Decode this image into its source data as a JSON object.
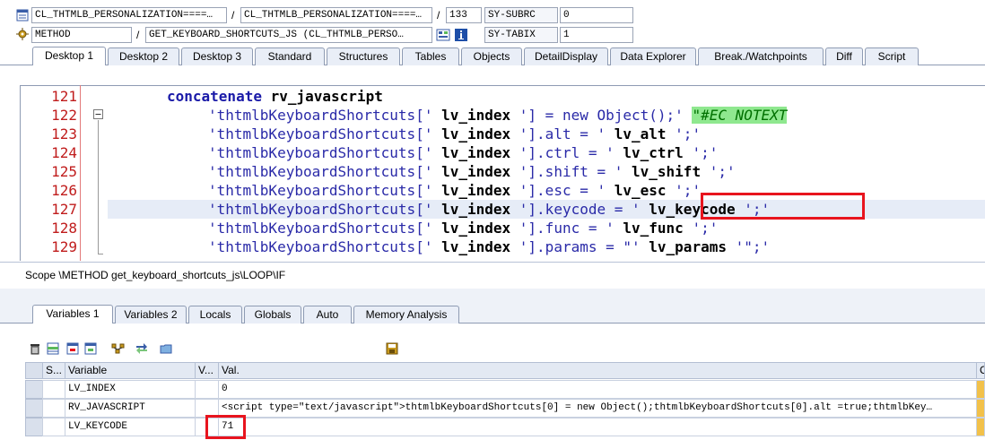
{
  "header": {
    "row1": {
      "class1": "CL_THTMLB_PERSONALIZATION====…",
      "class2": "CL_THTMLB_PERSONALIZATION====…",
      "line": "133",
      "sysvar": "SY-SUBRC",
      "sysval": "0"
    },
    "row2": {
      "type": "METHOD",
      "method": "GET_KEYBOARD_SHORTCUTS_JS (CL_THTMLB_PERSO…",
      "sysvar": "SY-TABIX",
      "sysval": "1"
    }
  },
  "tabs": [
    "Desktop 1",
    "Desktop 2",
    "Desktop 3",
    "Standard",
    "Structures",
    "Tables",
    "Objects",
    "DetailDisplay",
    "Data Explorer",
    "Break./Watchpoints",
    "Diff",
    "Script"
  ],
  "code_lines": {
    "l121": {
      "no": "121",
      "kw": "concatenate",
      "rest": " rv_javascript"
    },
    "l122": {
      "no": "122",
      "s1": "'thtmlbKeyboardShortcuts['",
      "v": " lv_index ",
      "s2": "'] = new Object();'",
      "cmt": "\"#EC NOTEXT"
    },
    "l123": {
      "no": "123",
      "s1": "'thtmlbKeyboardShortcuts['",
      "v": " lv_index ",
      "s2": "'].alt = '",
      "v2": " lv_alt ",
      "s3": "';'"
    },
    "l124": {
      "no": "124",
      "s1": "'thtmlbKeyboardShortcuts['",
      "v": " lv_index ",
      "s2": "'].ctrl = '",
      "v2": " lv_ctrl ",
      "s3": "';'"
    },
    "l125": {
      "no": "125",
      "s1": "'thtmlbKeyboardShortcuts['",
      "v": " lv_index ",
      "s2": "'].shift = '",
      "v2": " lv_shift ",
      "s3": "';'"
    },
    "l126": {
      "no": "126",
      "s1": "'thtmlbKeyboardShortcuts['",
      "v": " lv_index ",
      "s2": "'].esc = '",
      "v2": " lv_esc ",
      "s3": "';'"
    },
    "l127": {
      "no": "127",
      "s1": "'thtmlbKeyboardShortcuts['",
      "v": " lv_index ",
      "s2": "'].keycode = '",
      "v2": " lv_keycode ",
      "s3": "';'"
    },
    "l128": {
      "no": "128",
      "s1": "'thtmlbKeyboardShortcuts['",
      "v": " lv_index ",
      "s2": "'].func = '",
      "v2": " lv_func ",
      "s3": "';'"
    },
    "l129": {
      "no": "129",
      "s1": "'thtmlbKeyboardShortcuts['",
      "v": " lv_index ",
      "s2": "'].params = \"'",
      "v2": " lv_params ",
      "s3": "'\";'"
    }
  },
  "scope": "Scope \\METHOD get_keyboard_shortcuts_js\\LOOP\\IF",
  "var_tabs": [
    "Variables 1",
    "Variables 2",
    "Locals",
    "Globals",
    "Auto",
    "Memory Analysis"
  ],
  "grid": {
    "headers": {
      "s": "S...",
      "variable": "Variable",
      "v": "V...",
      "val": "Val.",
      "c": "C"
    },
    "rows": [
      {
        "variable": "LV_INDEX",
        "val": "0"
      },
      {
        "variable": "RV_JAVASCRIPT",
        "val": "<script type=\"text/javascript\">thtmlbKeyboardShortcuts[0] = new Object();thtmlbKeyboardShortcuts[0].alt =true;thtmlbKey…"
      },
      {
        "variable": "LV_KEYCODE",
        "val": "71"
      }
    ]
  },
  "colors": {
    "highlight": "#e8141e",
    "tab_bg": "#e9eef7",
    "line_numbers": "#c01c1c",
    "keyword": "#1a1aa8",
    "comment_bg": "#8fe88f"
  },
  "icons": [
    "class-icon",
    "method-icon",
    "overview-icon",
    "info-icon",
    "delete-icon",
    "save-icon"
  ]
}
